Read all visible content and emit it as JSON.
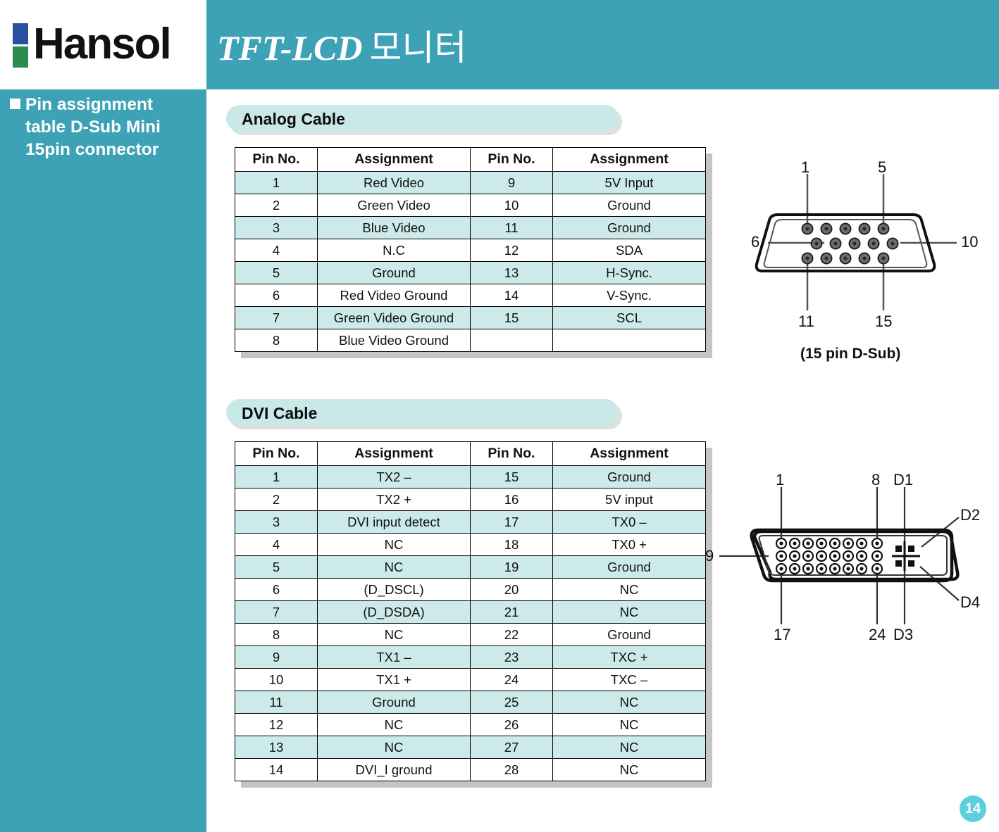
{
  "header": {
    "logo_text": "Hansol",
    "title_main": "TFT-LCD",
    "title_kr": "모니터"
  },
  "sidebar": {
    "heading_line1": "Pin assignment",
    "heading_line2": "table D-Sub Mini",
    "heading_line3": "15pin connector"
  },
  "sections": {
    "analog": {
      "pill_label": "Analog Cable",
      "columns": [
        "Pin No.",
        "Assignment",
        "Pin No.",
        "Assignment"
      ],
      "rows": [
        [
          "1",
          "Red Video",
          "9",
          "5V Input"
        ],
        [
          "2",
          "Green Video",
          "10",
          "Ground"
        ],
        [
          "3",
          "Blue Video",
          "11",
          "Ground"
        ],
        [
          "4",
          "N.C",
          "12",
          "SDA"
        ],
        [
          "5",
          "Ground",
          "13",
          "H-Sync."
        ],
        [
          "6",
          "Red Video Ground",
          "14",
          "V-Sync."
        ],
        [
          "7",
          "Green Video Ground",
          "15",
          "SCL"
        ],
        [
          "8",
          "Blue Video Ground",
          "",
          ""
        ]
      ]
    },
    "dvi": {
      "pill_label": "DVI Cable",
      "columns": [
        "Pin No.",
        "Assignment",
        "Pin No.",
        "Assignment"
      ],
      "rows": [
        [
          "1",
          "TX2 –",
          "15",
          "Ground"
        ],
        [
          "2",
          "TX2 +",
          "16",
          "5V input"
        ],
        [
          "3",
          "DVI input detect",
          "17",
          "TX0 –"
        ],
        [
          "4",
          "NC",
          "18",
          "TX0 +"
        ],
        [
          "5",
          "NC",
          "19",
          "Ground"
        ],
        [
          "6",
          "(D_DSCL)",
          "20",
          "NC"
        ],
        [
          "7",
          "(D_DSDA)",
          "21",
          "NC"
        ],
        [
          "8",
          "NC",
          "22",
          "Ground"
        ],
        [
          "9",
          "TX1 –",
          "23",
          "TXC +"
        ],
        [
          "10",
          "TX1 +",
          "24",
          "TXC –"
        ],
        [
          "11",
          "Ground",
          "25",
          "NC"
        ],
        [
          "12",
          "NC",
          "26",
          "NC"
        ],
        [
          "13",
          "NC",
          "27",
          "NC"
        ],
        [
          "14",
          "DVI_I ground",
          "28",
          "NC"
        ]
      ]
    }
  },
  "diagrams": {
    "dsub": {
      "label_top_left": "1",
      "label_top_right": "5",
      "label_left": "6",
      "label_right": "10",
      "label_bottom_left": "11",
      "label_bottom_right": "15",
      "caption": "(15 pin D-Sub)"
    },
    "dvi": {
      "label_top_left": "1",
      "label_top_right": "8",
      "label_top_d": "D1",
      "label_left": "9",
      "label_right_upper": "D2",
      "label_right_lower": "D4",
      "label_bottom_left": "17",
      "label_bottom_right": "24",
      "label_bottom_d": "D3"
    }
  },
  "footer": {
    "page_number": "14"
  },
  "colors": {
    "teal": "#3ea2b7",
    "pill": "#c9e8e8",
    "row_alt": "#cdeaea",
    "badge": "#5ecfdc",
    "logo_blue": "#2b4fa0",
    "logo_green": "#2e8b4f"
  }
}
